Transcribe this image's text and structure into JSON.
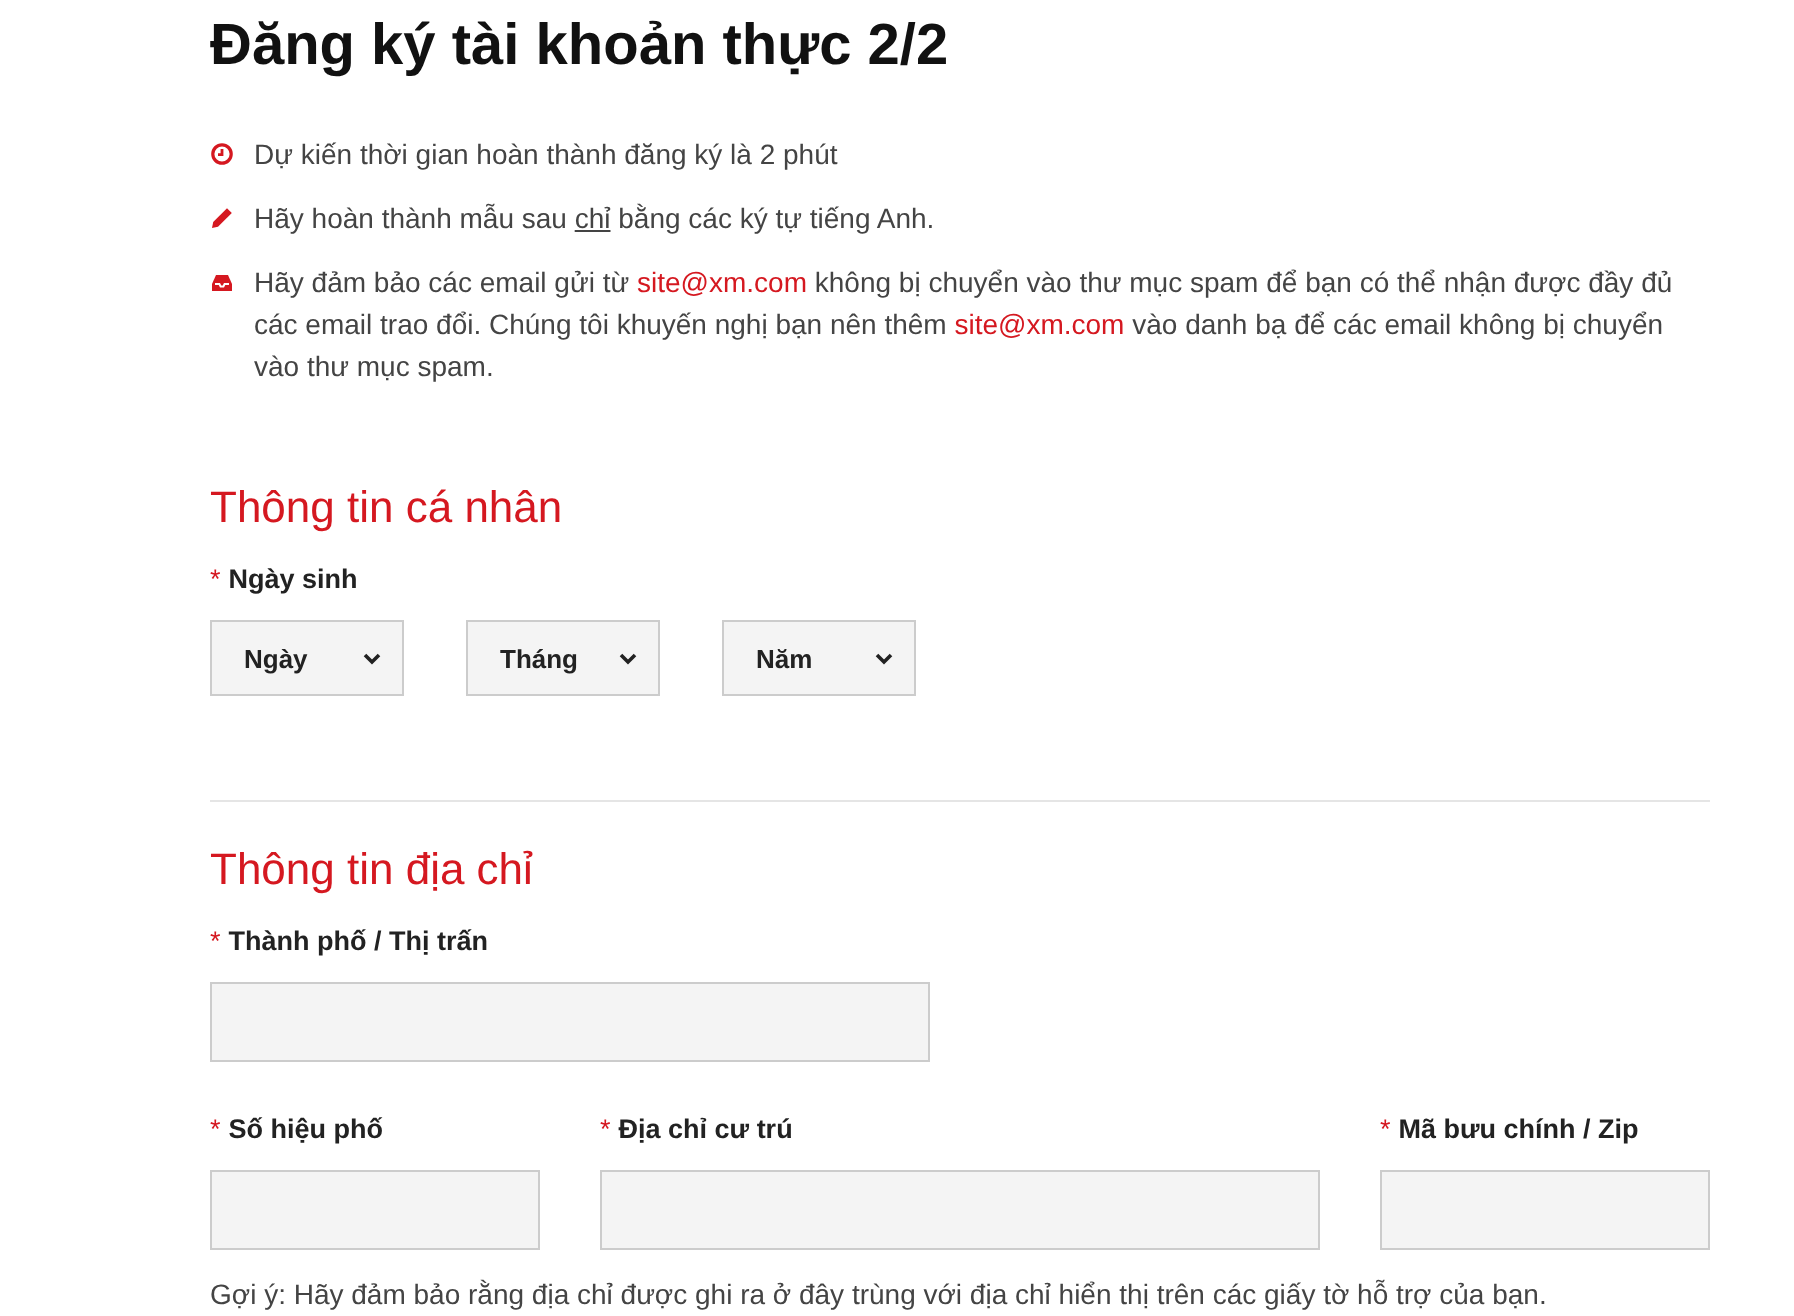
{
  "title": "Đăng ký tài khoản thực 2/2",
  "notes": [
    {
      "parts": [
        {
          "kind": "text",
          "text": "Dự kiến thời gian hoàn thành đăng ký là 2 phút"
        }
      ]
    },
    {
      "parts": [
        {
          "kind": "text",
          "text": "Hãy hoàn thành mẫu sau "
        },
        {
          "kind": "underlined",
          "text": "chỉ"
        },
        {
          "kind": "text",
          "text": " bằng các ký tự tiếng Anh."
        }
      ]
    },
    {
      "parts": [
        {
          "kind": "text",
          "text": "Hãy đảm bảo các email gửi từ "
        },
        {
          "kind": "link",
          "text": "site@xm.com"
        },
        {
          "kind": "text",
          "text": " không bị chuyển vào thư mục spam để bạn có thể nhận được đầy đủ các email trao đổi. Chúng tôi khuyến nghị bạn nên thêm "
        },
        {
          "kind": "link",
          "text": "site@xm.com"
        },
        {
          "kind": "text",
          "text": " vào danh bạ để các email không bị chuyển vào thư mục spam."
        }
      ]
    }
  ],
  "personal": {
    "heading": "Thông tin cá nhân",
    "birth_label": "Ngày sinh",
    "required_mark": "*",
    "selects": [
      {
        "value": "Ngày"
      },
      {
        "value": "Tháng"
      },
      {
        "value": "Năm"
      }
    ]
  },
  "address": {
    "heading": "Thông tin địa chỉ",
    "rows": [
      [
        {
          "label": "Thành phố / Thị trấn",
          "required_mark": "*"
        }
      ],
      [
        {
          "label": "Số hiệu phố",
          "required_mark": "*"
        },
        {
          "label": "Địa chỉ cư trú",
          "required_mark": "*"
        },
        {
          "label": "Mã bưu chính / Zip",
          "required_mark": "*"
        }
      ]
    ],
    "hint": "Gợi ý: Hãy đảm bảo rằng địa chỉ được ghi ra ở đây trùng với địa chỉ hiển thị trên các giấy tờ hỗ trợ của bạn."
  }
}
